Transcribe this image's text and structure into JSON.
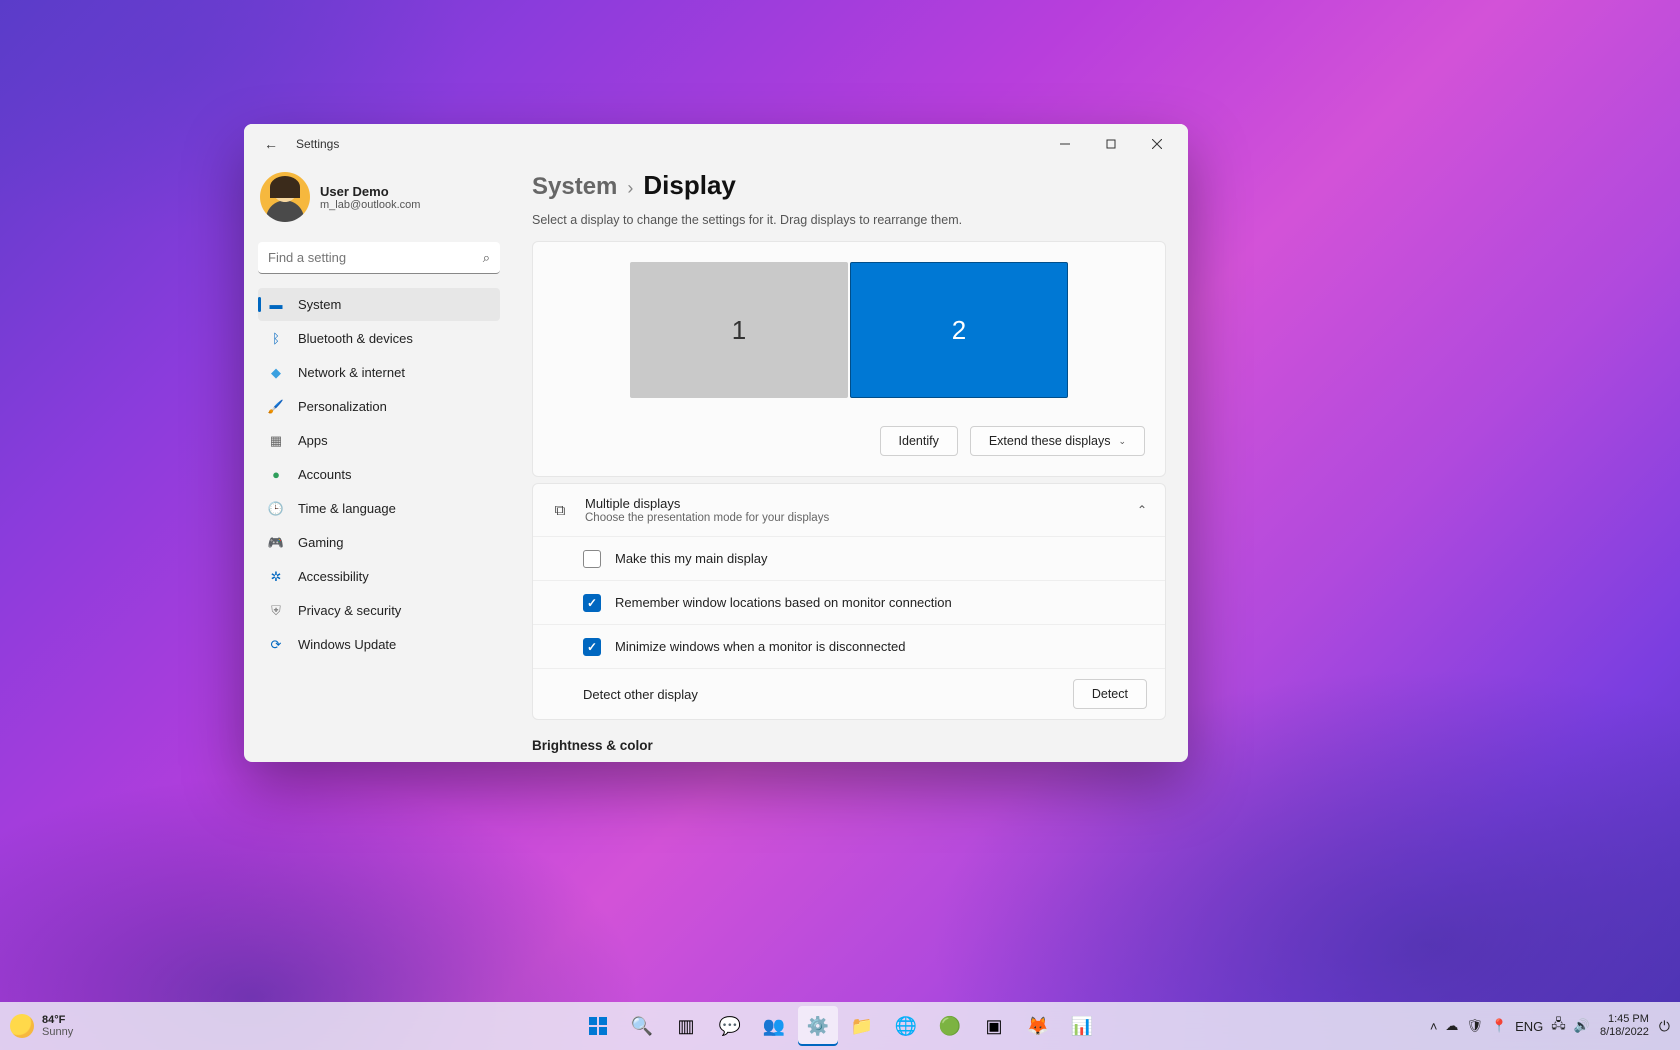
{
  "window": {
    "title": "Settings",
    "breadcrumb": {
      "parent": "System",
      "current": "Display"
    },
    "hint": "Select a display to change the settings for it. Drag displays to rearrange them."
  },
  "user": {
    "name": "User Demo",
    "email": "m_lab@outlook.com"
  },
  "search": {
    "placeholder": "Find a setting"
  },
  "nav": {
    "items": [
      {
        "label": "System",
        "icon": "🖥️",
        "active": true
      },
      {
        "label": "Bluetooth & devices",
        "icon": "●"
      },
      {
        "label": "Network & internet",
        "icon": "💎"
      },
      {
        "label": "Personalization",
        "icon": "🖌️"
      },
      {
        "label": "Apps",
        "icon": "▦"
      },
      {
        "label": "Accounts",
        "icon": "👤"
      },
      {
        "label": "Time & language",
        "icon": "🌐"
      },
      {
        "label": "Gaming",
        "icon": "🎮"
      },
      {
        "label": "Accessibility",
        "icon": "✲"
      },
      {
        "label": "Privacy & security",
        "icon": "🛡️"
      },
      {
        "label": "Windows Update",
        "icon": "🔄"
      }
    ]
  },
  "displays": {
    "monitors": [
      {
        "id": "1",
        "selected": false
      },
      {
        "id": "2",
        "selected": true
      }
    ],
    "identify": "Identify",
    "mode": "Extend these displays"
  },
  "multiple": {
    "title": "Multiple displays",
    "subtitle": "Choose the presentation mode for your displays",
    "opts": {
      "main": "Make this my main display",
      "remember": "Remember window locations based on monitor connection",
      "minimize": "Minimize windows when a monitor is disconnected"
    },
    "detect_label": "Detect other display",
    "detect_btn": "Detect"
  },
  "section2": "Brightness & color",
  "taskbar": {
    "weather": {
      "temp": "84°F",
      "cond": "Sunny"
    },
    "lang": "ENG",
    "time": "1:45 PM",
    "date": "8/18/2022"
  }
}
